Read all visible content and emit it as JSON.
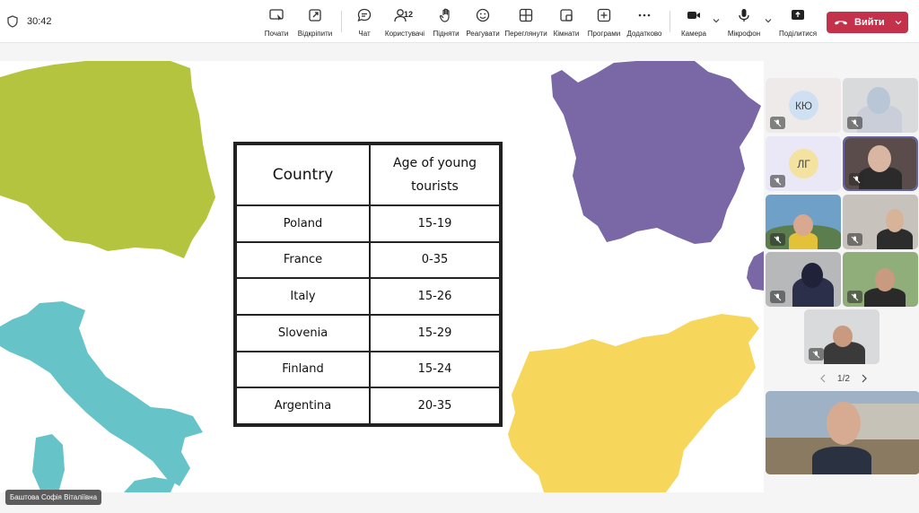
{
  "meeting": {
    "timer": "30:42",
    "participant_count": "12"
  },
  "toolbar": {
    "start_label": "Почати",
    "detach_label": "Відкріпити",
    "chat_label": "Чат",
    "people_label": "Користувачі",
    "raise_label": "Підняти",
    "react_label": "Реагувати",
    "view_label": "Переглянути",
    "rooms_label": "Кімнати",
    "apps_label": "Програми",
    "more_label": "Додатково",
    "camera_label": "Камера",
    "mic_label": "Мікрофон",
    "share_label": "Поділитися",
    "leave_label": "Вийти"
  },
  "slide": {
    "table": {
      "header": [
        "Country",
        "Age of young tourists"
      ],
      "rows": [
        [
          "Poland",
          "15-19"
        ],
        [
          "France",
          "0-35"
        ],
        [
          "Italy",
          "15-26"
        ],
        [
          "Slovenia",
          "15-29"
        ],
        [
          "Finland",
          "15-24"
        ],
        [
          "Argentina",
          "20-35"
        ]
      ]
    },
    "colors": {
      "poland": "#b5c43e",
      "france": "#7a67a6",
      "italy": "#66c4c9",
      "slovenia": "#f6d75c"
    }
  },
  "presenter_name": "Баштова Софія Віталіївна",
  "gallery": {
    "avatars": [
      {
        "initials": "КЮ",
        "color": "#cfe0f2",
        "tile_bg": "#eeeaea"
      },
      {
        "initials": "ЛГ",
        "color": "#f4e2a0",
        "tile_bg": "#eae7f6"
      }
    ],
    "page": "1/2",
    "accent": "#6264a7"
  }
}
